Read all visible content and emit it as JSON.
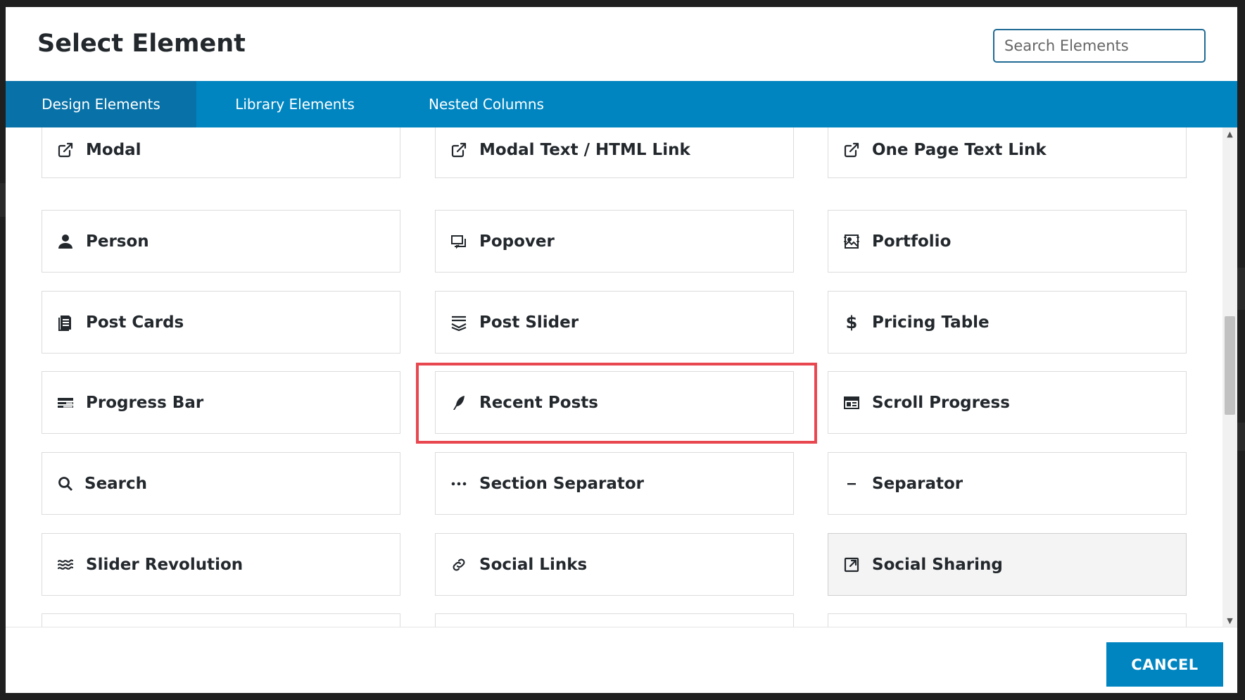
{
  "dialog": {
    "title": "Select Element",
    "search_placeholder": "Search Elements",
    "search_value": ""
  },
  "tabs": [
    {
      "label": "Design Elements",
      "active": true
    },
    {
      "label": "Library Elements",
      "active": false
    },
    {
      "label": "Nested Columns",
      "active": false
    }
  ],
  "elements": [
    {
      "label": "Modal",
      "icon": "external-link-icon"
    },
    {
      "label": "Modal Text / HTML Link",
      "icon": "external-link-icon"
    },
    {
      "label": "One Page Text Link",
      "icon": "external-link-icon"
    },
    {
      "label": "Person",
      "icon": "user-icon"
    },
    {
      "label": "Popover",
      "icon": "popover-icon"
    },
    {
      "label": "Portfolio",
      "icon": "portfolio-icon"
    },
    {
      "label": "Post Cards",
      "icon": "document-icon"
    },
    {
      "label": "Post Slider",
      "icon": "layers-icon"
    },
    {
      "label": "Pricing Table",
      "icon": "dollar-icon"
    },
    {
      "label": "Progress Bar",
      "icon": "bars-icon"
    },
    {
      "label": "Recent Posts",
      "icon": "feather-icon"
    },
    {
      "label": "Scroll Progress",
      "icon": "scroll-progress-icon"
    },
    {
      "label": "Search",
      "icon": "search-icon"
    },
    {
      "label": "Section Separator",
      "icon": "ellipsis-icon"
    },
    {
      "label": "Separator",
      "icon": "minus-icon"
    },
    {
      "label": "Slider Revolution",
      "icon": "waves-icon"
    },
    {
      "label": "Social Links",
      "icon": "link-icon"
    },
    {
      "label": "Social Sharing",
      "icon": "share-icon"
    }
  ],
  "highlighted_element": "Recent Posts",
  "hovered_element": "Social Sharing",
  "footer": {
    "cancel_label": "CANCEL"
  },
  "colors": {
    "tab_bar": "#0085c1",
    "active_tab": "#0872a8",
    "highlight_box": "#e9474f",
    "cancel_button": "#0085c1",
    "search_border": "#1f6b94"
  }
}
